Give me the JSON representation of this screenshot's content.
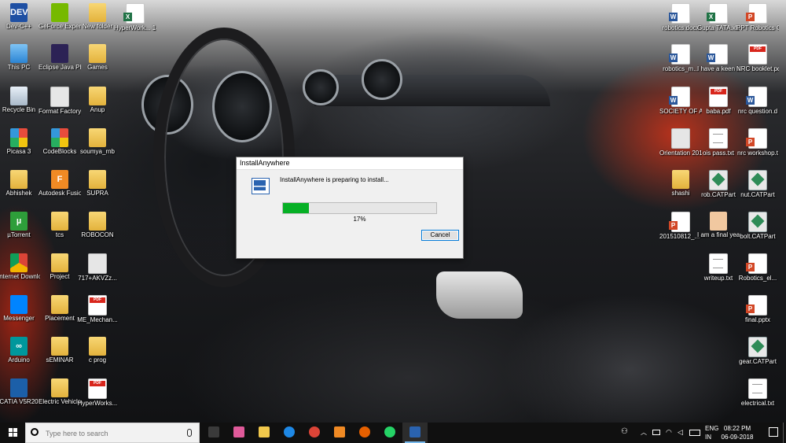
{
  "desktop_icons": [
    {
      "label": "Dev-C++",
      "icon": "devcpp-icon",
      "style": "g-dev",
      "glyph": "DEV"
    },
    {
      "label": "GeForce Experience",
      "icon": "nvidia-icon",
      "style": "g-nvidia",
      "glyph": ""
    },
    {
      "label": "New folder",
      "icon": "folder-icon",
      "style": "g-folder",
      "glyph": ""
    },
    {
      "label": "HyperWork... 14.0 License...",
      "icon": "excel-file-icon",
      "style": "g-excel",
      "glyph": ""
    },
    {
      "label": "This PC",
      "icon": "this-pc-icon",
      "style": "g-pc",
      "glyph": ""
    },
    {
      "label": "Eclipse Java Photon",
      "icon": "eclipse-icon",
      "style": "g-eclipse",
      "glyph": ""
    },
    {
      "label": "Games",
      "icon": "folder-icon",
      "style": "g-folder",
      "glyph": ""
    },
    {
      "label": "Recycle Bin",
      "icon": "recycle-bin-icon",
      "style": "g-bin",
      "glyph": ""
    },
    {
      "label": "Format Factory",
      "icon": "format-factory-icon",
      "style": "g-img",
      "glyph": ""
    },
    {
      "label": "Anup",
      "icon": "folder-icon",
      "style": "g-folder",
      "glyph": ""
    },
    {
      "label": "Picasa 3",
      "icon": "picasa-icon",
      "style": "g-picasa",
      "glyph": ""
    },
    {
      "label": "CodeBlocks",
      "icon": "codeblocks-icon",
      "style": "g-picasa",
      "glyph": ""
    },
    {
      "label": "soumya_rnb",
      "icon": "folder-icon",
      "style": "g-folder",
      "glyph": ""
    },
    {
      "label": "Abhishek",
      "icon": "folder-icon",
      "style": "g-folder",
      "glyph": ""
    },
    {
      "label": "Autodesk Fusion 360",
      "icon": "fusion360-icon",
      "style": "g-orange",
      "glyph": "F"
    },
    {
      "label": "SUPRA",
      "icon": "folder-icon",
      "style": "g-folder",
      "glyph": ""
    },
    {
      "label": "µTorrent",
      "icon": "utorrent-icon",
      "style": "g-green",
      "glyph": "µ"
    },
    {
      "label": "tcs",
      "icon": "folder-icon",
      "style": "g-folder",
      "glyph": ""
    },
    {
      "label": "ROBOCON",
      "icon": "folder-icon",
      "style": "g-folder",
      "glyph": ""
    },
    {
      "label": "Internet Downloa...",
      "icon": "internet-download-manager-icon",
      "style": "g-chrome",
      "glyph": ""
    },
    {
      "label": "Project",
      "icon": "folder-icon",
      "style": "g-folder",
      "glyph": ""
    },
    {
      "label": "717+AKVZz...",
      "icon": "image-file-icon",
      "style": "g-img",
      "glyph": ""
    },
    {
      "label": "Messenger",
      "icon": "messenger-icon",
      "style": "g-msgr",
      "glyph": ""
    },
    {
      "label": "Placement",
      "icon": "folder-icon",
      "style": "g-folder",
      "glyph": ""
    },
    {
      "label": "ME_Mechan...",
      "icon": "pdf-file-icon",
      "style": "g-pdf",
      "glyph": ""
    },
    {
      "label": "Arduino",
      "icon": "arduino-icon",
      "style": "g-arduino",
      "glyph": "∞"
    },
    {
      "label": "sEMINAR",
      "icon": "folder-icon",
      "style": "g-folder",
      "glyph": ""
    },
    {
      "label": "c prog",
      "icon": "folder-icon",
      "style": "g-folder",
      "glyph": ""
    },
    {
      "label": "CATIA V5R20",
      "icon": "catia-icon",
      "style": "g-catia",
      "glyph": ""
    },
    {
      "label": "Electric Vehicle",
      "icon": "folder-icon",
      "style": "g-folder",
      "glyph": ""
    },
    {
      "label": "HyperWorks...",
      "icon": "pdf-file-icon",
      "style": "g-pdf",
      "glyph": ""
    },
    {
      "label": "robotics.docx",
      "icon": "word-file-icon",
      "style": "g-word",
      "glyph": ""
    },
    {
      "label": "Gupta TATA.xls",
      "icon": "excel-file-icon",
      "style": "g-excel",
      "glyph": ""
    },
    {
      "label": "PPT Robotics Club.pptx",
      "icon": "powerpoint-file-icon",
      "style": "g-ppt",
      "glyph": ""
    },
    {
      "label": "robotics_m...",
      "icon": "word-file-icon",
      "style": "g-word",
      "glyph": ""
    },
    {
      "label": "I have a keen interest tow...",
      "icon": "word-file-icon",
      "style": "g-word",
      "glyph": ""
    },
    {
      "label": "NRC booklet.pdf",
      "icon": "pdf-file-icon",
      "style": "g-pdf",
      "glyph": ""
    },
    {
      "label": "SOCIETY OF AUTOMOTI...",
      "icon": "word-file-icon",
      "style": "g-word",
      "glyph": ""
    },
    {
      "label": "baba.pdf",
      "icon": "pdf-file-icon",
      "style": "g-pdf",
      "glyph": ""
    },
    {
      "label": "nrc question.d",
      "icon": "word-file-icon",
      "style": "g-word",
      "glyph": ""
    },
    {
      "label": "Orientation 2018.pptx",
      "icon": "powerpoint-file-icon",
      "style": "g-img",
      "glyph": ""
    },
    {
      "label": "ois pass.txt",
      "icon": "text-file-icon",
      "style": "g-txt",
      "glyph": ""
    },
    {
      "label": "nrc workshop.t",
      "icon": "powerpoint-file-icon",
      "style": "g-ppt",
      "glyph": ""
    },
    {
      "label": "shashi",
      "icon": "folder-icon",
      "style": "g-folder",
      "glyph": ""
    },
    {
      "label": "rob.CATPart",
      "icon": "catpart-file-icon",
      "style": "g-catpart",
      "glyph": ""
    },
    {
      "label": "nut.CATPart",
      "icon": "catpart-file-icon",
      "style": "g-catpart",
      "glyph": ""
    },
    {
      "label": "201510812_... KUMAR SAT...",
      "icon": "powerpoint-file-icon",
      "style": "g-ppt",
      "glyph": ""
    },
    {
      "label": "I am a final year stude...",
      "icon": "person-image-icon",
      "style": "g-person",
      "glyph": ""
    },
    {
      "label": "bolt.CATPart",
      "icon": "catpart-file-icon",
      "style": "g-catpart",
      "glyph": ""
    },
    {
      "label": "writeup.txt",
      "icon": "text-file-icon",
      "style": "g-txt",
      "glyph": ""
    },
    {
      "label": "Robotics_el...",
      "icon": "powerpoint-file-icon",
      "style": "g-ppt",
      "glyph": ""
    },
    {
      "label": "final.pptx",
      "icon": "powerpoint-file-icon",
      "style": "g-ppt",
      "glyph": ""
    },
    {
      "label": "gear.CATPart",
      "icon": "catpart-file-icon",
      "style": "g-catpart",
      "glyph": ""
    },
    {
      "label": "electrical.txt",
      "icon": "text-file-icon",
      "style": "g-txt",
      "glyph": ""
    }
  ],
  "dialog": {
    "title": "InstallAnywhere",
    "message": "InstallAnywhere is preparing to install...",
    "progress_fraction": 0.17,
    "progress_text": "17%",
    "cancel_label": "Cancel"
  },
  "taskbar": {
    "search_placeholder": "Type here to search",
    "apps": [
      {
        "name": "task-view",
        "color": "#3a3a3a"
      },
      {
        "name": "paint-3d",
        "color": "#e05a9a"
      },
      {
        "name": "file-explorer",
        "color": "#f2c94c"
      },
      {
        "name": "edge",
        "color": "#1e88e5"
      },
      {
        "name": "chrome",
        "color": "#db4437"
      },
      {
        "name": "vlc",
        "color": "#f08a24"
      },
      {
        "name": "firefox",
        "color": "#e66000"
      },
      {
        "name": "whatsapp",
        "color": "#25d366"
      },
      {
        "name": "installanywhere",
        "color": "#2a63b0"
      }
    ],
    "language_line1": "ENG",
    "language_line2": "IN",
    "time": "08:22 PM",
    "date": "06-09-2018"
  }
}
